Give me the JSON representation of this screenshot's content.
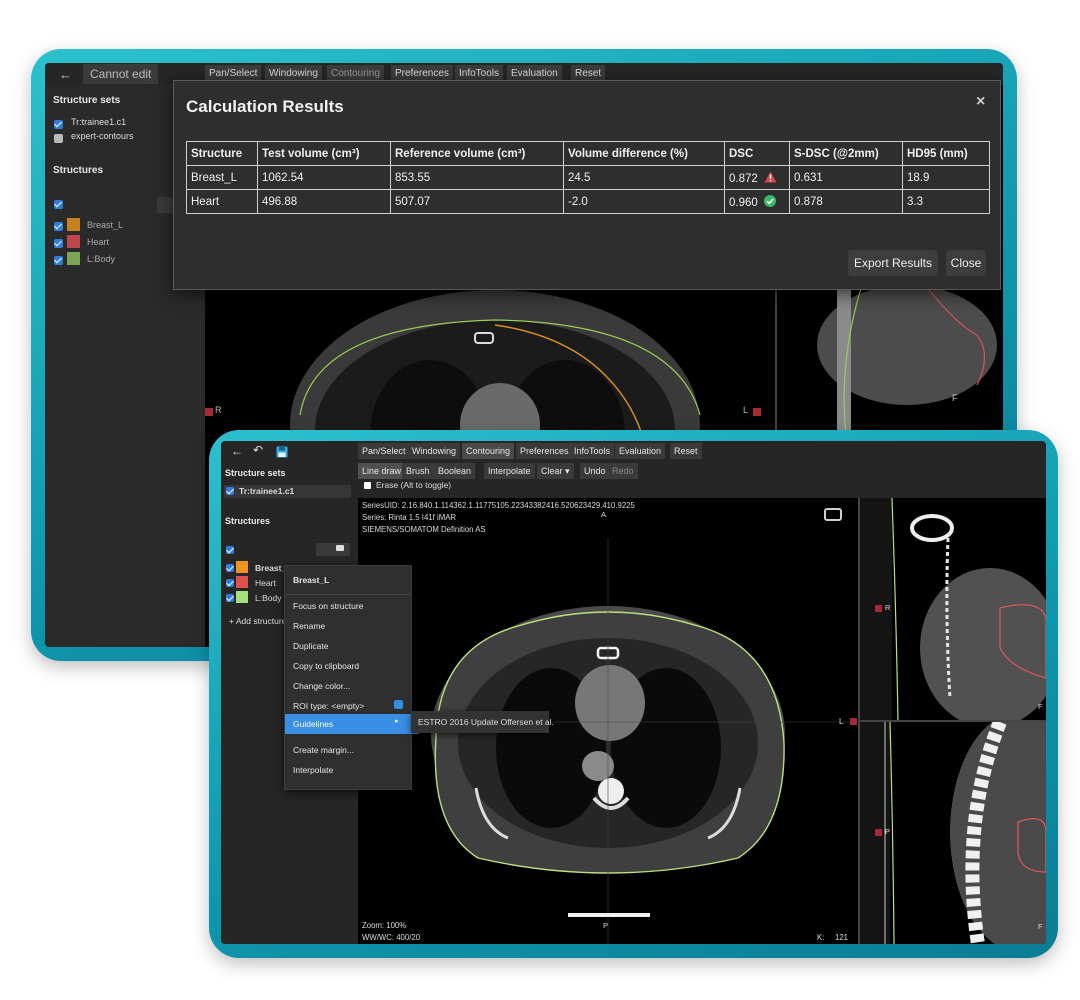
{
  "back_app": {
    "cannot_edit": "Cannot edit",
    "menu": [
      "Pan/Select",
      "Windowing",
      "Contouring",
      "Preferences",
      "InfoTools",
      "Evaluation",
      "Reset"
    ],
    "structure_sets_title": "Structure sets",
    "structure_sets": [
      {
        "label": "Tr:trainee1.c1",
        "checked": true
      },
      {
        "label": "expert-contours",
        "checked": false
      }
    ],
    "structures_title": "Structures",
    "structures": [
      {
        "label": "Breast_L",
        "color": "#c7821f"
      },
      {
        "label": "Heart",
        "color": "#c0464a"
      },
      {
        "label": "L:Body",
        "color": "#7aa654"
      }
    ],
    "marker_r": "R",
    "marker_l": "L",
    "marker_f": "F"
  },
  "dialog": {
    "title": "Calculation Results",
    "close_glyph": "×",
    "headers": [
      "Structure",
      "Test volume (cm³)",
      "Reference volume (cm³)",
      "Volume difference (%)",
      "DSC",
      "S-DSC (@2mm)",
      "HD95 (mm)"
    ],
    "rows": [
      {
        "structure": "Breast_L",
        "test": "1062.54",
        "ref": "853.55",
        "diff": "24.5",
        "dsc": "0.872",
        "dsc_icon": "warning-icon",
        "sdsc": "0.631",
        "hd95": "18.9"
      },
      {
        "structure": "Heart",
        "test": "496.88",
        "ref": "507.07",
        "diff": "-2.0",
        "dsc": "0.960",
        "dsc_icon": "check-circle-icon",
        "sdsc": "0.878",
        "hd95": "3.3"
      }
    ],
    "export_label": "Export Results",
    "close_label": "Close"
  },
  "front_app": {
    "menu": [
      "Pan/Select",
      "Windowing",
      "Contouring",
      "Preferences",
      "InfoTools",
      "Evaluation",
      "Reset"
    ],
    "tools": [
      "Line draw",
      "Brush",
      "Boolean",
      "Interpolate",
      "Clear ▾",
      "Undo",
      "Redo"
    ],
    "erase_label": "Erase (Alt to toggle)",
    "structure_sets_title": "Structure sets",
    "structure_set": "Tr:trainee1.c1",
    "structures_title": "Structures",
    "structures": [
      {
        "label": "Breast_L",
        "color": "#f0941f"
      },
      {
        "label": "Heart",
        "color": "#e0504f"
      },
      {
        "label": "L:Body",
        "color": "#a6e07a"
      }
    ],
    "add_structure": "+  Add structure",
    "overlay_series_uid": "SeriesUID: 2.16.840.1.114362.1.11775105.22343382416.520623429.410.9225",
    "overlay_series": "Series: Rinta 1.5 I41f iMAR",
    "overlay_scanner": "SIEMENS/SOMATOM Definition AS",
    "zoom": "Zoom: 100%",
    "wwwc": "WW/WC: 400/20",
    "slice_label": "K:",
    "slice_value": "121",
    "marker_a": "A",
    "marker_p": "P",
    "marker_r": "R",
    "marker_l": "L",
    "marker_f": "F"
  },
  "context_menu": {
    "title": "Breast_L",
    "items": [
      "Focus on structure",
      "Rename",
      "Duplicate",
      "Copy to clipboard",
      "Change color...",
      "ROI type: <empty>",
      "Guidelines",
      "Create margin...",
      "Interpolate"
    ],
    "submenu_item": "ESTRO 2016 Update Offersen et al.",
    "highlight_color": "#3a8ee6"
  }
}
